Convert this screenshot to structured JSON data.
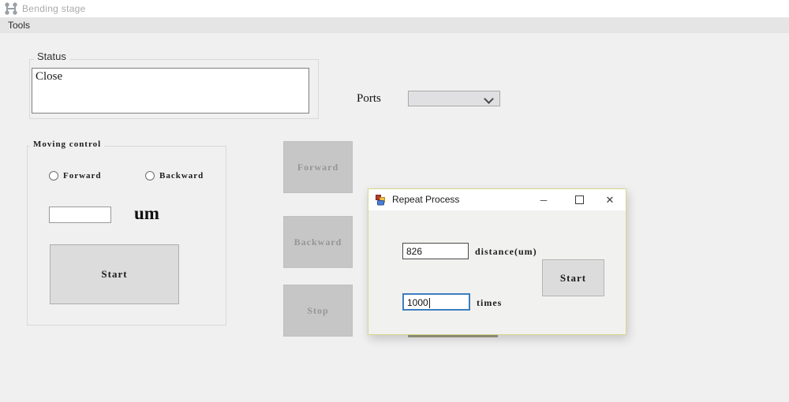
{
  "app": {
    "title": "Bending stage",
    "menu_items": [
      {
        "label": "Tools"
      }
    ]
  },
  "status_group": {
    "title": "Status",
    "text": "Close"
  },
  "ports": {
    "label": "Ports",
    "selected_value": ""
  },
  "moving_control": {
    "title": "Moving control",
    "forward_label": "Forward",
    "backward_label": "Backward",
    "distance_value": "",
    "unit_label": "um",
    "start_label": "Start"
  },
  "jog_buttons": {
    "forward_label": "Forward",
    "backward_label": "Backward",
    "stop_label": "Stop"
  },
  "repeat_dialog": {
    "title": "Repeat Process",
    "minimize_glyph": "─",
    "close_glyph": "✕",
    "distance_value": "826",
    "distance_label": "distance(um)",
    "times_value": "1000",
    "times_label": "times",
    "start_label": "Start"
  },
  "colors": {
    "window_bg": "#f0f0f0",
    "menubar_bg": "#e5e5e5",
    "button_bg": "#dcdcdc",
    "disabled_button_bg": "#c6c6c6",
    "disabled_button_text": "#969696",
    "dialog_border": "#d6d68c",
    "focus_border": "#3c7ec0"
  }
}
